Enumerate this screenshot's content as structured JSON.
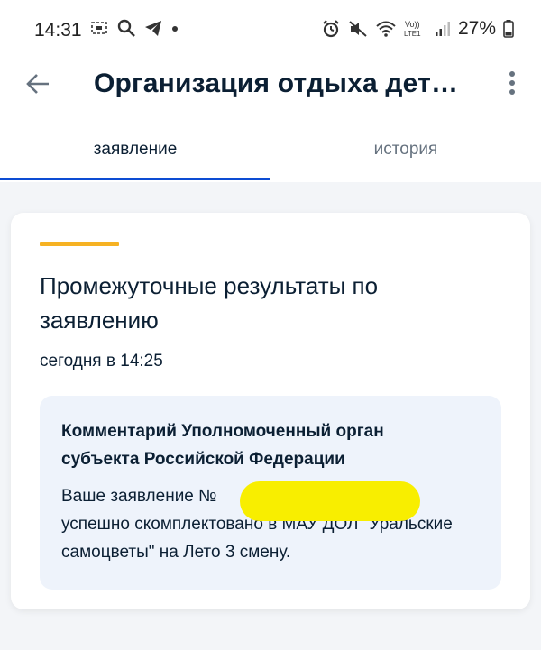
{
  "status_bar": {
    "time": "14:31",
    "battery": "27%",
    "left_icons": [
      "screenshot-icon",
      "search-icon",
      "telegram-icon",
      "dot-icon"
    ],
    "right_icons": [
      "alarm-icon",
      "mute-icon",
      "wifi-icon",
      "volte-icon",
      "signal-icon",
      "battery-icon"
    ]
  },
  "appbar": {
    "title": "Организация отдыха дет…"
  },
  "tabs": [
    {
      "label": "заявление",
      "active": true
    },
    {
      "label": "история",
      "active": false
    }
  ],
  "card": {
    "title": "Промежуточные результаты по заявлению",
    "date": "сегодня в 14:25",
    "comment": {
      "title": "Комментарий Уполномоченный орган субъекта Российской Федерации",
      "text_line1": "Ваше заявление №",
      "text_rest": "успешно скомплектовано в МАУ ДОЛ \"Уральские самоцветы\" на Лето 3 смену."
    }
  },
  "colors": {
    "accent_yellow": "#f6b223",
    "tab_active": "#0d4cd3",
    "comment_bg": "#eef3fb",
    "redaction": "#f8ee00"
  }
}
